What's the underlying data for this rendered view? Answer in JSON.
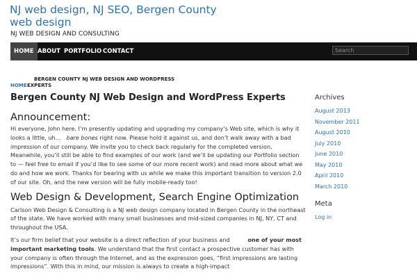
{
  "site": {
    "title": "NJ web design, NJ SEO, Bergen County web design",
    "description": "NJ WEB DESIGN AND CONSULTING"
  },
  "nav": {
    "items": [
      "HOME",
      "ABOUT",
      "PORTFOLIO",
      "CONTACT"
    ],
    "search_placeholder": "Search"
  },
  "breadcrumb": {
    "home": "HOME",
    "current_line1": "BERGEN COUNTY NJ WEB DESIGN AND WORDPRESS",
    "current_line2": "EXPERTS"
  },
  "page": {
    "title": "Bergen County NJ Web Design and WordPress Experts",
    "announcement_heading": "Announcement:",
    "announcement_pre": "Hi everyone, John here. I’m presently updating and upgrading my company’s Web site, which is why it looks a little, uh…",
    "announcement_em": "bare bones",
    "announcement_post": " right now. Please hold it against us, and don’t walk away with a bad impression of our company. We invite you to check back regularly for the completed version. Meanwhile, you’ll still be able to find examples of our work (and we’ll be updating our Portfolio section to — feel free to email if you’d like to see some of our more recent work) and read more about what we do and how we work. Thanks for bearing with us while we make this important transition to version 2.0 of our site. Oh, and the new version will be fully mobile-ready too!",
    "section_heading": "Web Design & Development, Search Engine Optimization",
    "para1": "Carlson Web Design & Consulting is a NJ web design company located in Bergen County in the northeast of the state. We have worked with many small businesses and mid-sized companies in NJ, NY, CT and throughout the USA.",
    "para2_pre": "It’s our firm belief that your website is a direct reflection of your business and",
    "para2_bold": "one of your most important marketing tools",
    "para2_post": ".  We understand that the first contact a prospective customer has with your company is often through the Internet, and as the expression goes, “first impressions are lasting impressions”. With this in mind, our mission is always to create a high-impact"
  },
  "sidebar": {
    "archives_title": "Archives",
    "archives": [
      "August 2013",
      "November 2011",
      "August 2010",
      "July 2010",
      "June 2010",
      "May 2010",
      "April 2010",
      "March 2010"
    ],
    "meta_title": "Meta",
    "meta": [
      "Log in"
    ]
  }
}
